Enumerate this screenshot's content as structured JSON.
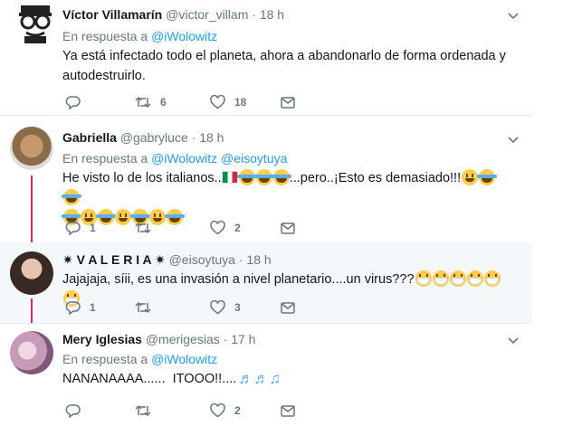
{
  "tweets": [
    {
      "name": "Víctor Villamarín",
      "handle": "@victor_villam",
      "dot": "·",
      "time": "18 h",
      "reply_prefix": "En respuesta a",
      "reply_to": "@iWolowitz",
      "reply_to_2": "",
      "text": "Ya está infectado todo el planeta, ahora a abandonarlo de forma ordenada y autodestruirlo.",
      "replies": "",
      "retweets": "6",
      "likes": "18"
    },
    {
      "name": "Gabriella",
      "handle": "@gabryluce",
      "dot": "·",
      "time": "18 h",
      "reply_prefix": "En respuesta a",
      "reply_to": "@iWolowitz",
      "reply_to_2": "@eisoytuya",
      "text": "He visto lo de los italianos..",
      "text_after": "...pero..¡Esto es demasiado!!!",
      "replies": "1",
      "retweets": "",
      "likes": "2"
    },
    {
      "name": "✷ V A L E R I A ✷",
      "handle": "@eisoytuya",
      "dot": "·",
      "time": "18 h",
      "text": "Jajajaja, síii, es una invasión a nivel planetario....un virus???",
      "replies": "1",
      "retweets": "",
      "likes": "3"
    },
    {
      "name": "Mery Iglesias",
      "handle": "@merigesias",
      "dot": "·",
      "time": "17 h",
      "reply_prefix": "En respuesta a",
      "reply_to": "@iWolowitz",
      "reply_to_2": "",
      "text": "NANANAAAA......  ITOOO!!....",
      "replies": "",
      "retweets": "",
      "likes": "2"
    }
  ],
  "colors": {
    "accent": "#1da1f2",
    "thread": "#e0245e",
    "muted": "#657786",
    "highlight_bg": "#f5f8fa"
  },
  "icons": [
    "chevron-down-icon",
    "reply-icon",
    "retweet-icon",
    "like-icon",
    "direct-message-icon",
    "emoji-joy",
    "emoji-smile",
    "emoji-mask",
    "flag-italy",
    "music-notes"
  ]
}
